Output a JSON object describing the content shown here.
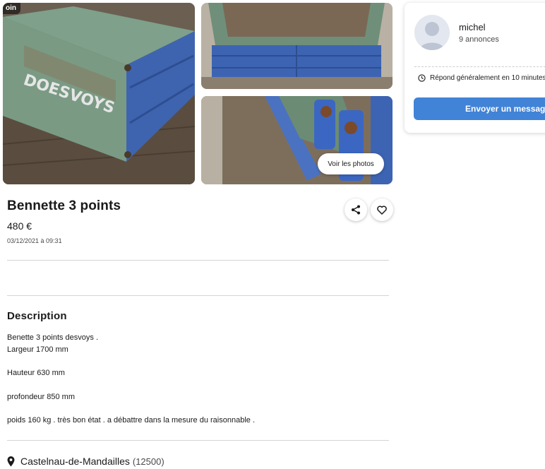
{
  "gallery": {
    "corner_label": "oin",
    "see_photos_label": "Voir les photos",
    "main_photo_text": "DOESVOYS"
  },
  "listing": {
    "title": "Bennette 3 points",
    "price": "480 €",
    "date": "03/12/2021 à 09:31"
  },
  "actions": {
    "share_icon": "share-icon",
    "favorite_icon": "heart-icon"
  },
  "description": {
    "heading": "Description",
    "lines": [
      "Benette 3 points desvoys .",
      "Largeur 1700 mm",
      "Hauteur 630 mm",
      "profondeur 850 mm",
      "poids 160 kg . très bon état . a débattre dans la mesure du raisonnable ."
    ]
  },
  "location": {
    "city": "Castelnau-de-Mandailles",
    "zip": "(12500)",
    "icon": "map-pin-icon"
  },
  "seller": {
    "name": "michel",
    "listings_count": "9 annonces",
    "response_time": "Répond généralement en 10 minutes",
    "message_button": "Envoyer un message",
    "accent_color": "#4183d7"
  }
}
